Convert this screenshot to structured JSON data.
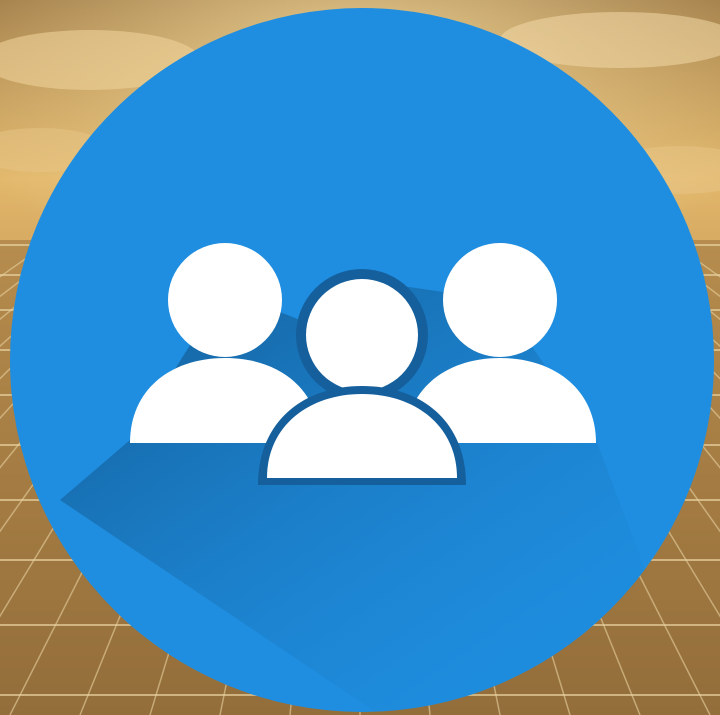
{
  "scene": {
    "background": {
      "sky_colors": [
        "#c9a060",
        "#e6c07a",
        "#8c6a3a"
      ],
      "panel_color": "#9a7440",
      "panel_line_color": "#e8d2a0"
    },
    "badge": {
      "circle_color": "#1f8ee0",
      "shadow_color": "#12588f",
      "figure_color": "#ffffff",
      "icon": "users-group-icon",
      "figure_count": 3
    }
  }
}
